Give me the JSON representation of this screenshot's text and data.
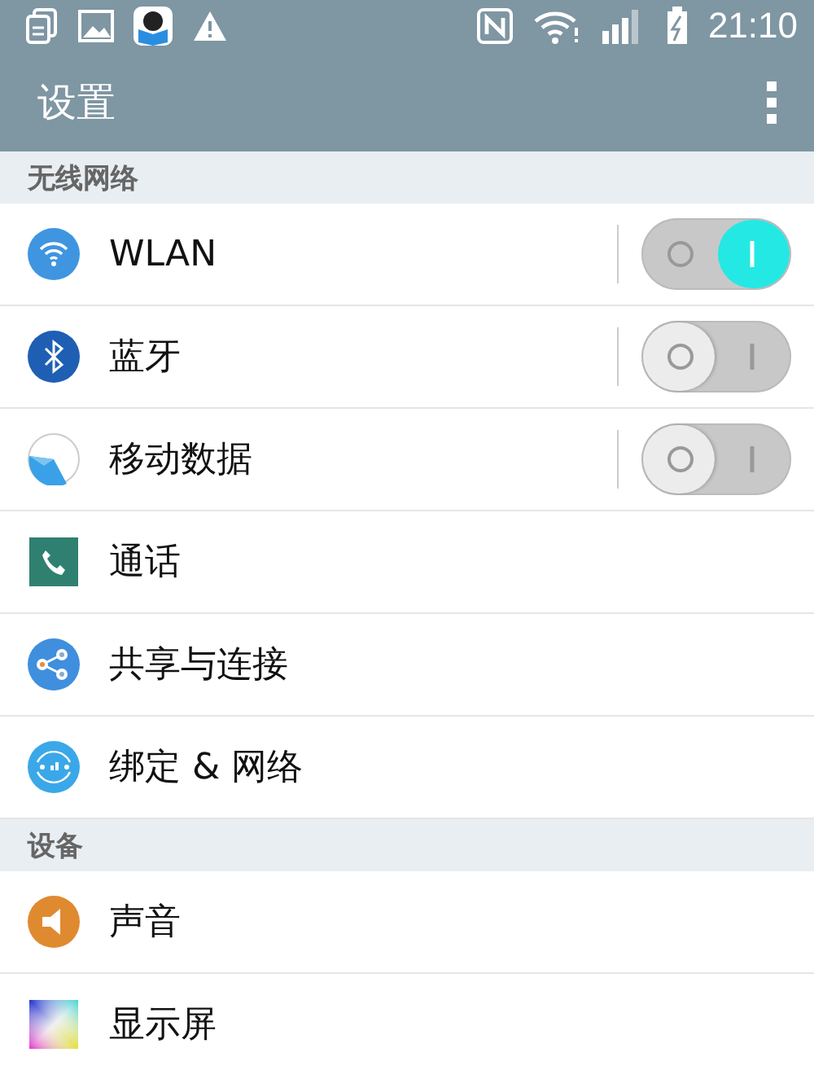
{
  "status_bar": {
    "time": "21:10"
  },
  "app_bar": {
    "title": "设置"
  },
  "sections": [
    {
      "header": "无线网络",
      "items": [
        {
          "label": "WLAN",
          "kind": "toggle",
          "on": true
        },
        {
          "label": "蓝牙",
          "kind": "toggle",
          "on": false
        },
        {
          "label": "移动数据",
          "kind": "toggle",
          "on": false
        },
        {
          "label": "通话",
          "kind": "link"
        },
        {
          "label": "共享与连接",
          "kind": "link"
        },
        {
          "label": "绑定 & 网络",
          "kind": "link"
        }
      ]
    },
    {
      "header": "设备",
      "items": [
        {
          "label": "声音",
          "kind": "link"
        },
        {
          "label": "显示屏",
          "kind": "link"
        }
      ]
    }
  ]
}
